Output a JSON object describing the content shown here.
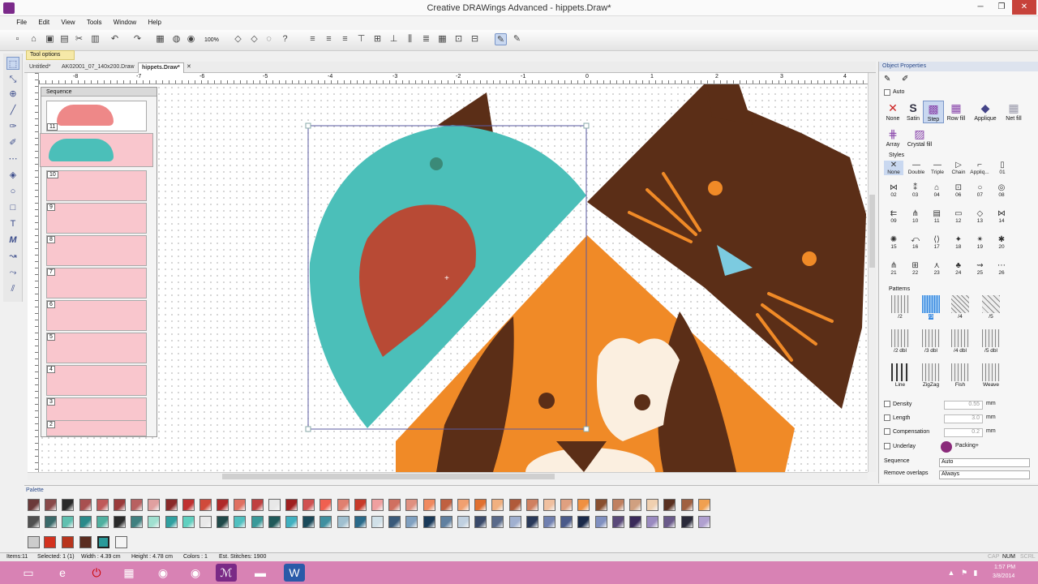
{
  "window": {
    "title": "Creative DRAWings Advanced - hippets.Draw*",
    "min": "─",
    "max": "❐",
    "close": "✕"
  },
  "menu": [
    "File",
    "Edit",
    "View",
    "Tools",
    "Window",
    "Help"
  ],
  "toolbar": {
    "zoom": "100%"
  },
  "tool_options": "Tool options",
  "tabs": [
    {
      "label": "Untitled*"
    },
    {
      "label": "AK02001_07_140x200.Draw"
    },
    {
      "label": "hippets.Draw*",
      "active": true
    }
  ],
  "ruler": {
    "unit": "cm",
    "h_ticks": [
      "-8",
      "-7",
      "-6",
      "-5",
      "-4",
      "-3",
      "-2",
      "-1",
      "0",
      "1",
      "2",
      "3",
      "4"
    ],
    "v_ticks": [
      "5",
      "4",
      "3",
      "2",
      "1",
      "0",
      "-1",
      "-2",
      "-3",
      "-4",
      "-5"
    ]
  },
  "sequence": {
    "title": "Sequence",
    "items": [
      "11",
      "10",
      "9",
      "8",
      "7",
      "6",
      "5",
      "4",
      "3",
      "2"
    ]
  },
  "object_properties": {
    "title": "Object Properties",
    "auto": "Auto",
    "fills": [
      {
        "label": "None",
        "icon": "x-icon"
      },
      {
        "label": "Satin",
        "icon": "s-icon"
      },
      {
        "label": "Step",
        "icon": "step-icon",
        "active": true
      },
      {
        "label": "Row fill",
        "icon": "rowfill-icon"
      },
      {
        "label": "Applique",
        "icon": "applique-icon"
      },
      {
        "label": "Net fill",
        "icon": "netfill-icon"
      },
      {
        "label": "Array",
        "icon": "array-icon"
      },
      {
        "label": "Crystal fill",
        "icon": "crystal-icon"
      }
    ],
    "styles_label": "Styles",
    "styles": [
      "None",
      "Double",
      "Triple",
      "Chain",
      "Appliq...",
      "01",
      "02",
      "03",
      "04",
      "06",
      "07",
      "08",
      "09",
      "10",
      "11",
      "12",
      "13",
      "14",
      "15",
      "16",
      "17",
      "18",
      "19",
      "20",
      "21",
      "22",
      "23",
      "24",
      "25",
      "26"
    ],
    "patterns_label": "Patterns",
    "patterns": [
      "/2",
      "/3",
      "/4",
      "/5",
      "/2 dbl",
      "/3 dbl",
      "/4 dbl",
      "/5 dbl",
      "Line",
      "ZigZag",
      "Fish",
      "Weave"
    ],
    "density": {
      "label": "Density",
      "value": "0.55",
      "unit": "mm"
    },
    "length": {
      "label": "Length",
      "value": "3.0",
      "unit": "mm"
    },
    "compensation": {
      "label": "Compensation",
      "value": "0.2",
      "unit": "mm"
    },
    "underlay": {
      "label": "Underlay",
      "packing": "Packing+"
    },
    "sequence_label": "Sequence",
    "sequence_value": "Auto",
    "remove_overlaps_label": "Remove overlaps",
    "remove_overlaps_value": "Always"
  },
  "palette": {
    "title": "Palette"
  },
  "status": {
    "items": "Items:11",
    "selected": "Selected: 1 (1)",
    "width": "Width : 4.39 cm",
    "height": "Height : 4.78 cm",
    "colors": "Colors : 1",
    "stitches": "Est. Stitches: 1900",
    "cap": "CAP",
    "num": "NUM",
    "scrl": "SCRL"
  },
  "taskbar": {
    "time": "1:57 PM",
    "date": "3/8/2014"
  },
  "colors": {
    "teal": "#4bbfb9",
    "red": "#b84a35",
    "brown": "#5b2e17",
    "orange": "#f08a27",
    "lightblue": "#7ccbe0",
    "pink": "#f9c6cd"
  }
}
